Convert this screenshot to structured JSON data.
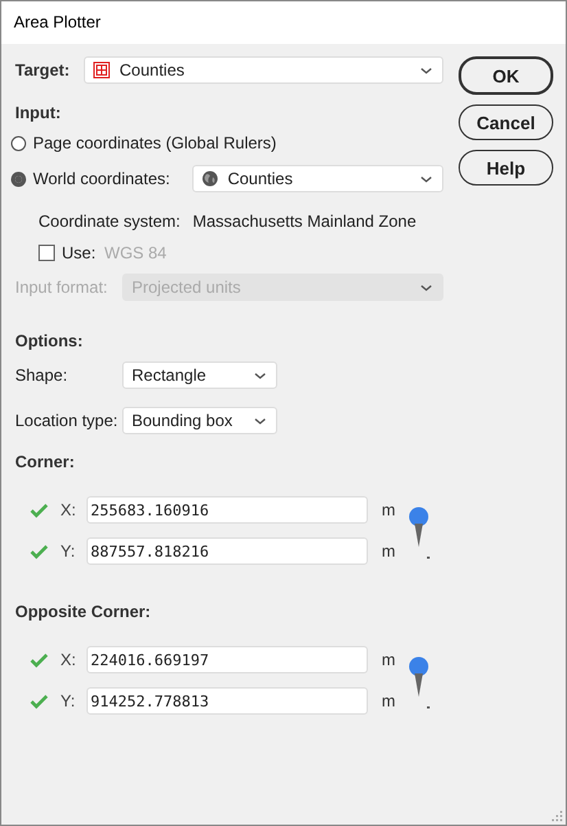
{
  "window": {
    "title": "Area Plotter"
  },
  "target": {
    "label": "Target:",
    "value": "Counties"
  },
  "buttons": [
    {
      "label": "OK",
      "default": true
    },
    {
      "label": "Cancel",
      "default": false
    },
    {
      "label": "Help",
      "default": false
    }
  ],
  "input": {
    "heading": "Input:",
    "options": [
      {
        "label": "Page coordinates (Global Rulers)",
        "selected": false
      },
      {
        "label": "World coordinates:",
        "selected": true,
        "layer": "Counties"
      }
    ],
    "coordinate_system": {
      "label": "Coordinate system:",
      "value": "Massachusetts Mainland Zone"
    },
    "use": {
      "label": "Use:",
      "value": "WGS 84",
      "checked": false
    },
    "input_format": {
      "label": "Input format:",
      "value": "Projected units",
      "disabled": true
    }
  },
  "options": {
    "heading": "Options:",
    "fields": [
      {
        "label": "Shape:",
        "value": "Rectangle"
      },
      {
        "label": "Location type:",
        "value": "Bounding box"
      }
    ]
  },
  "points": [
    {
      "heading": "Corner:",
      "coords": [
        {
          "label": "X:",
          "value": "255683.160916",
          "unit": "m",
          "valid": true
        },
        {
          "label": "Y:",
          "value": "887557.818216",
          "unit": "m",
          "valid": true
        }
      ]
    },
    {
      "heading": "Opposite Corner:",
      "coords": [
        {
          "label": "X:",
          "value": "224016.669197",
          "unit": "m",
          "valid": true
        },
        {
          "label": "Y:",
          "value": "914252.778813",
          "unit": "m",
          "valid": true
        }
      ]
    }
  ]
}
